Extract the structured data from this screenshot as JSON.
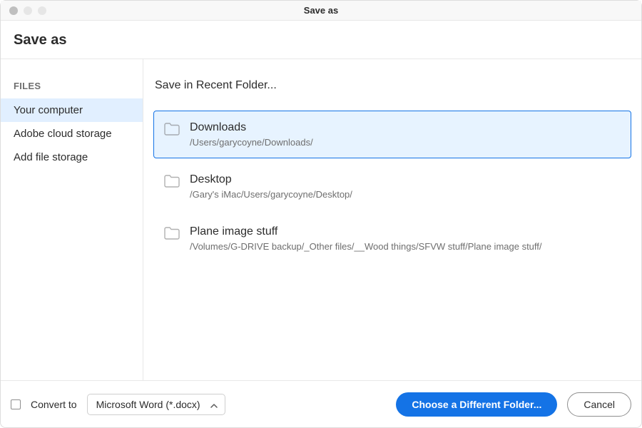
{
  "window": {
    "title": "Save as"
  },
  "header": {
    "title": "Save as"
  },
  "sidebar": {
    "heading": "FILES",
    "items": [
      {
        "label": "Your computer",
        "selected": true
      },
      {
        "label": "Adobe cloud storage",
        "selected": false
      },
      {
        "label": "Add file storage",
        "selected": false
      }
    ]
  },
  "main": {
    "heading": "Save in Recent Folder...",
    "folders": [
      {
        "name": "Downloads",
        "path": "/Users/garycoyne/Downloads/",
        "selected": true
      },
      {
        "name": "Desktop",
        "path": "/Gary's iMac/Users/garycoyne/Desktop/",
        "selected": false
      },
      {
        "name": "Plane image stuff",
        "path": "/Volumes/G-DRIVE backup/_Other files/__Wood things/SFVW stuff/Plane image stuff/",
        "selected": false
      }
    ]
  },
  "footer": {
    "convert_checked": false,
    "convert_label": "Convert to",
    "format_selected": "Microsoft Word (*.docx)",
    "primary_label": "Choose a Different Folder...",
    "secondary_label": "Cancel"
  }
}
